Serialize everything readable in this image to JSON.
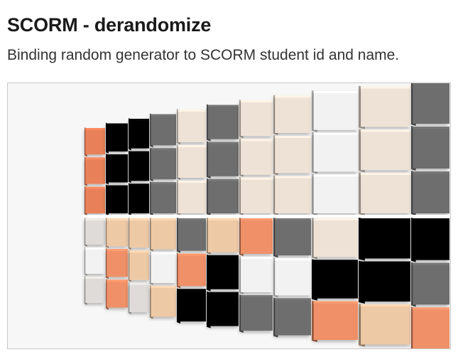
{
  "card": {
    "title": "SCORM - derandomize",
    "subtitle": "Binding random generator to SCORM student id and name."
  },
  "preview": {
    "image_name": "colored-cube-grid",
    "colors": {
      "orange": "#e8815a",
      "black": "#050505",
      "gray": "#6e6e6e",
      "white": "#f2f2f2",
      "light_gray": "#dedbd8",
      "peach": "#eec9a6",
      "cream": "#eee2d6",
      "salmon": "#ef9068"
    }
  }
}
